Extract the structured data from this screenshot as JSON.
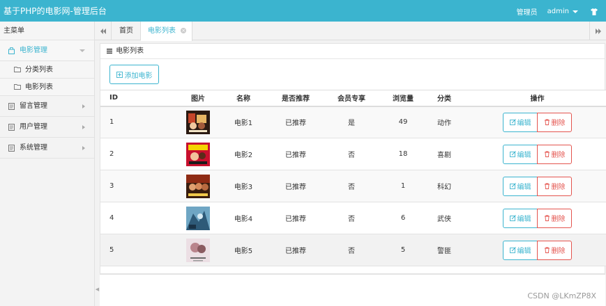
{
  "header": {
    "title": "基于PHP的电影网-管理后台",
    "role": "管理员",
    "username": "admin"
  },
  "sidebar": {
    "title": "主菜单",
    "items": [
      {
        "label": "电影管理",
        "children": [
          "分类列表",
          "电影列表"
        ]
      },
      {
        "label": "留言管理"
      },
      {
        "label": "用户管理"
      },
      {
        "label": "系统管理"
      }
    ]
  },
  "tabs": {
    "home": "首页",
    "active": "电影列表"
  },
  "panel": {
    "title": "电影列表",
    "add_button": "添加电影"
  },
  "table": {
    "headers": [
      "ID",
      "图片",
      "名称",
      "是否推荐",
      "会员专享",
      "浏览量",
      "分类",
      "操作"
    ],
    "edit_label": "编辑",
    "delete_label": "删除",
    "rows": [
      {
        "id": "1",
        "name": "电影1",
        "recommended": "已推荐",
        "vip": "是",
        "views": "49",
        "category": "动作"
      },
      {
        "id": "2",
        "name": "电影2",
        "recommended": "已推荐",
        "vip": "否",
        "views": "18",
        "category": "喜剧"
      },
      {
        "id": "3",
        "name": "电影3",
        "recommended": "已推荐",
        "vip": "否",
        "views": "1",
        "category": "科幻"
      },
      {
        "id": "4",
        "name": "电影4",
        "recommended": "已推荐",
        "vip": "否",
        "views": "6",
        "category": "武侠"
      },
      {
        "id": "5",
        "name": "电影5",
        "recommended": "已推荐",
        "vip": "否",
        "views": "5",
        "category": "警匪"
      }
    ]
  },
  "watermark": "CSDN @LKmZP8X",
  "colors": {
    "accent": "#3bb4cf",
    "danger": "#e4544e"
  }
}
